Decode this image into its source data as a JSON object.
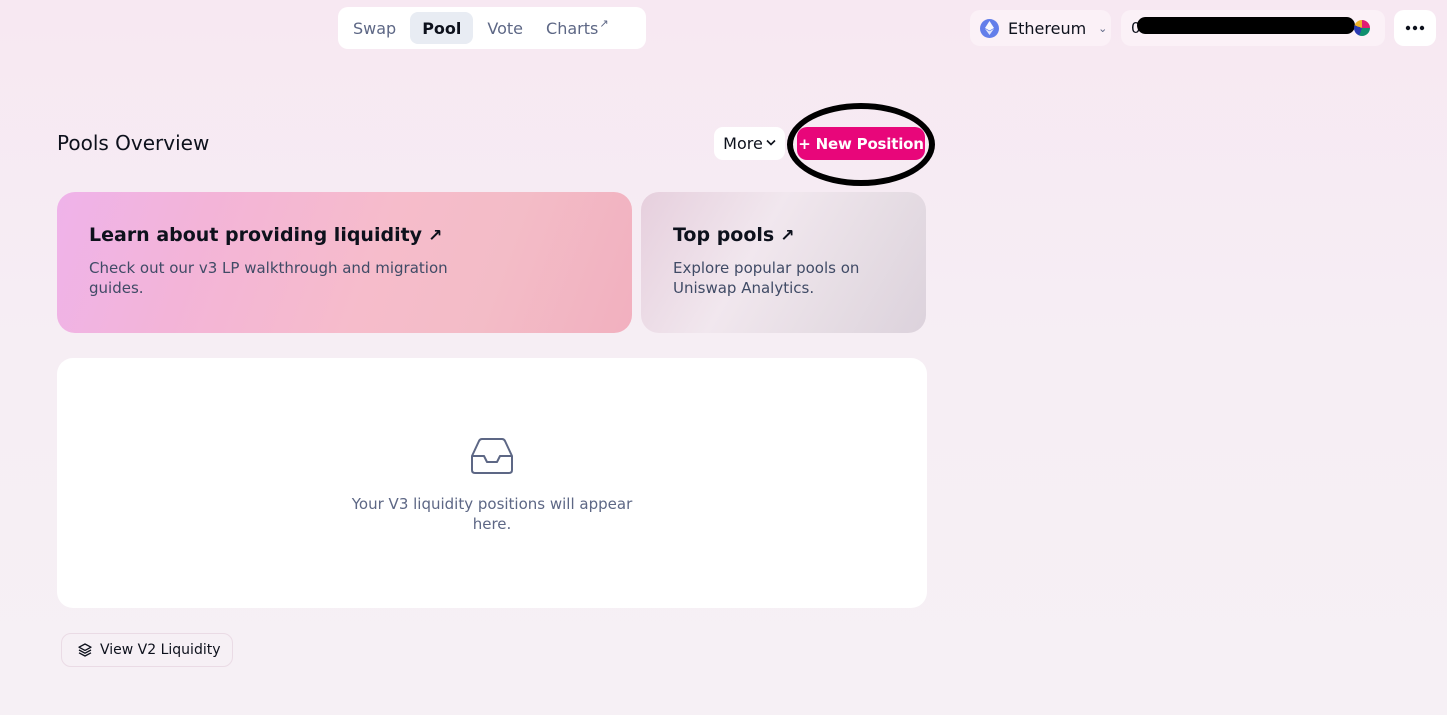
{
  "nav": {
    "items": [
      {
        "label": "Swap",
        "active": false
      },
      {
        "label": "Pool",
        "active": true
      },
      {
        "label": "Vote",
        "active": false
      },
      {
        "label": "Charts",
        "active": false,
        "suffix": "↗"
      }
    ]
  },
  "network": {
    "label": "Ethereum",
    "icon": "ethereum-icon"
  },
  "account": {
    "prefix": "0",
    "redacted": true
  },
  "header": {
    "title": "Pools Overview",
    "more_label": "More",
    "new_position_label": "+ New Position"
  },
  "cards": {
    "learn": {
      "title": "Learn about providing liquidity",
      "arrow": "↗",
      "description": "Check out our v3 LP walkthrough and migration guides."
    },
    "top_pools": {
      "title": "Top pools",
      "arrow": "↗",
      "description": "Explore popular pools on Uniswap Analytics."
    }
  },
  "positions": {
    "empty_message": "Your V3 liquidity positions will appear here."
  },
  "v2_button": {
    "label": "View V2 Liquidity"
  },
  "colors": {
    "accent": "#e8067a",
    "ethereum": "#627eea"
  }
}
